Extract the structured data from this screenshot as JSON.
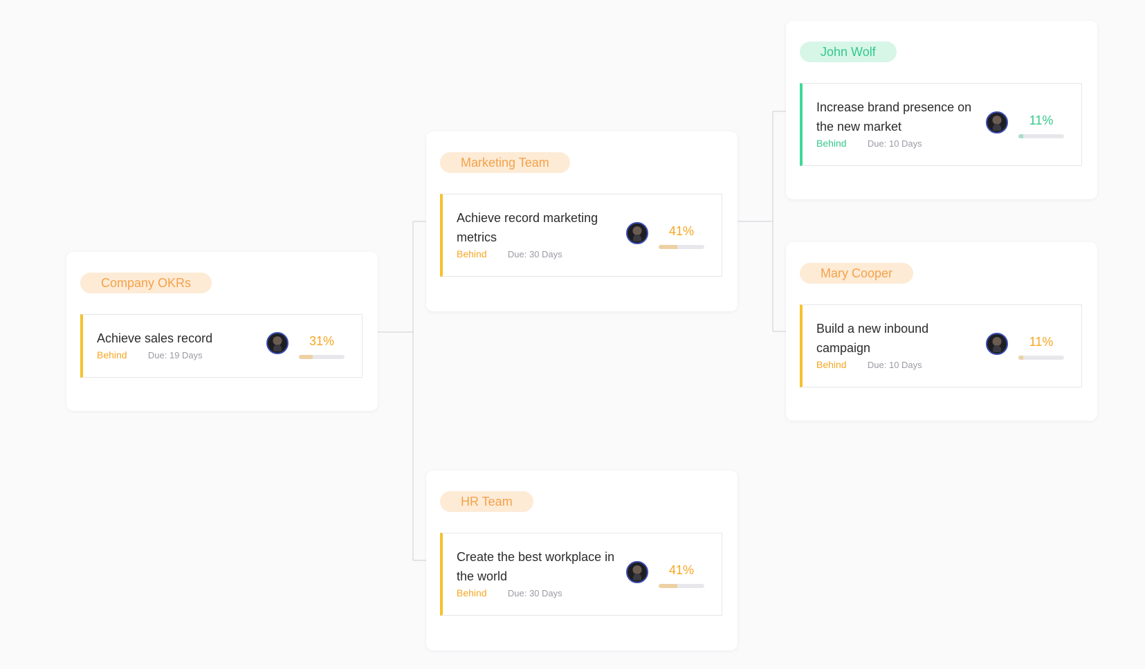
{
  "nodes": {
    "company": {
      "team_label": "Company OKRs",
      "okr": {
        "title": "Achieve sales record",
        "status": "Behind",
        "due": "Due: 19 Days",
        "progress": "31%"
      }
    },
    "marketing": {
      "team_label": "Marketing Team",
      "okr": {
        "title": "Achieve record marketing metrics",
        "status": "Behind",
        "due": "Due: 30 Days",
        "progress": "41%"
      }
    },
    "hr": {
      "team_label": "HR Team",
      "okr": {
        "title": "Create the best workplace in the world",
        "status": "Behind",
        "due": "Due: 30 Days",
        "progress": "41%"
      }
    },
    "john": {
      "team_label": "John Wolf",
      "okr": {
        "title": "Increase brand presence on the new market",
        "status": "Behind",
        "due": "Due: 10 Days",
        "progress": "11%"
      }
    },
    "mary": {
      "team_label": "Mary Cooper",
      "okr": {
        "title": "Build a new inbound campaign",
        "status": "Behind",
        "due": "Due: 10 Days",
        "progress": "11%"
      }
    }
  },
  "colors": {
    "orange": "#f6a623",
    "yellow_accent": "#f6c12d",
    "green": "#33c88b",
    "pill_orange_bg": "#fdebd6",
    "pill_green_bg": "#d7f6e8",
    "connector": "#cfcfd6"
  },
  "icons": {
    "owner_avatar": "avatar"
  }
}
